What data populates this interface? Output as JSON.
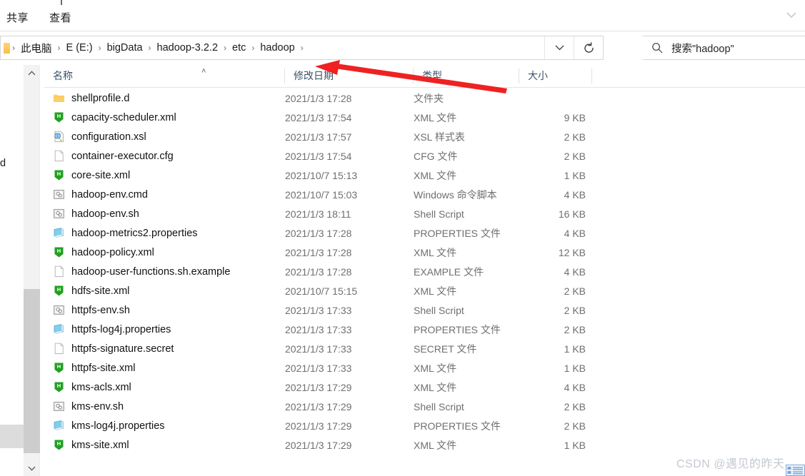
{
  "ribbon": {
    "tabs": [
      {
        "label": "共享",
        "name": "tab-share"
      },
      {
        "label": "查看",
        "name": "tab-view"
      }
    ],
    "expand_icon": "chevron-down-icon"
  },
  "address_bar": {
    "breadcrumbs": [
      "此电脑",
      "E (E:)",
      "bigData",
      "hadoop-3.2.2",
      "etc",
      "hadoop"
    ],
    "separator": "›",
    "history_dropdown_label": "⌄",
    "refresh_label": "↻"
  },
  "search": {
    "placeholder": "搜索\"hadoop\"",
    "icon": "search-icon"
  },
  "columns": {
    "name": "名称",
    "date": "修改日期",
    "type": "类型",
    "size": "大小",
    "sort_caret": "˄"
  },
  "navigation_pane": {
    "visible_text_fragment": "d"
  },
  "files": [
    {
      "name": "shellprofile.d",
      "date": "2021/1/3 17:28",
      "type": "文件夹",
      "size": "",
      "icon": "folder-icon"
    },
    {
      "name": "capacity-scheduler.xml",
      "date": "2021/1/3 17:54",
      "type": "XML 文件",
      "size": "9 KB",
      "icon": "hadoop-xml-icon"
    },
    {
      "name": "configuration.xsl",
      "date": "2021/1/3 17:57",
      "type": "XSL 样式表",
      "size": "2 KB",
      "icon": "xsl-stylesheet-icon"
    },
    {
      "name": "container-executor.cfg",
      "date": "2021/1/3 17:54",
      "type": "CFG 文件",
      "size": "2 KB",
      "icon": "blank-document-icon"
    },
    {
      "name": "core-site.xml",
      "date": "2021/10/7 15:13",
      "type": "XML 文件",
      "size": "1 KB",
      "icon": "hadoop-xml-icon"
    },
    {
      "name": "hadoop-env.cmd",
      "date": "2021/10/7 15:03",
      "type": "Windows 命令脚本",
      "size": "4 KB",
      "icon": "script-icon"
    },
    {
      "name": "hadoop-env.sh",
      "date": "2021/1/3 18:11",
      "type": "Shell Script",
      "size": "16 KB",
      "icon": "script-icon"
    },
    {
      "name": "hadoop-metrics2.properties",
      "date": "2021/1/3 17:28",
      "type": "PROPERTIES 文件",
      "size": "4 KB",
      "icon": "properties-icon"
    },
    {
      "name": "hadoop-policy.xml",
      "date": "2021/1/3 17:28",
      "type": "XML 文件",
      "size": "12 KB",
      "icon": "hadoop-xml-icon"
    },
    {
      "name": "hadoop-user-functions.sh.example",
      "date": "2021/1/3 17:28",
      "type": "EXAMPLE 文件",
      "size": "4 KB",
      "icon": "blank-document-icon"
    },
    {
      "name": "hdfs-site.xml",
      "date": "2021/10/7 15:15",
      "type": "XML 文件",
      "size": "2 KB",
      "icon": "hadoop-xml-icon"
    },
    {
      "name": "httpfs-env.sh",
      "date": "2021/1/3 17:33",
      "type": "Shell Script",
      "size": "2 KB",
      "icon": "script-icon"
    },
    {
      "name": "httpfs-log4j.properties",
      "date": "2021/1/3 17:33",
      "type": "PROPERTIES 文件",
      "size": "2 KB",
      "icon": "properties-icon"
    },
    {
      "name": "httpfs-signature.secret",
      "date": "2021/1/3 17:33",
      "type": "SECRET 文件",
      "size": "1 KB",
      "icon": "blank-document-icon"
    },
    {
      "name": "httpfs-site.xml",
      "date": "2021/1/3 17:33",
      "type": "XML 文件",
      "size": "1 KB",
      "icon": "hadoop-xml-icon"
    },
    {
      "name": "kms-acls.xml",
      "date": "2021/1/3 17:29",
      "type": "XML 文件",
      "size": "4 KB",
      "icon": "hadoop-xml-icon"
    },
    {
      "name": "kms-env.sh",
      "date": "2021/1/3 17:29",
      "type": "Shell Script",
      "size": "2 KB",
      "icon": "script-icon"
    },
    {
      "name": "kms-log4j.properties",
      "date": "2021/1/3 17:29",
      "type": "PROPERTIES 文件",
      "size": "2 KB",
      "icon": "properties-icon"
    },
    {
      "name": "kms-site.xml",
      "date": "2021/1/3 17:29",
      "type": "XML 文件",
      "size": "1 KB",
      "icon": "hadoop-xml-icon"
    }
  ],
  "scrollbar": {
    "up_arrow": "˄",
    "down_arrow": "˅"
  },
  "annotation": {
    "color": "#ee2222",
    "shape": "arrow-pointing-up-left"
  },
  "watermark": {
    "text": "CSDN @遇见的昨天"
  },
  "colors": {
    "folder": "#f6c04a",
    "hadoop_green": "#21a021",
    "properties_blue": "#74c6e8",
    "header_text": "#3b5169",
    "annotation_red": "#ee2222"
  }
}
